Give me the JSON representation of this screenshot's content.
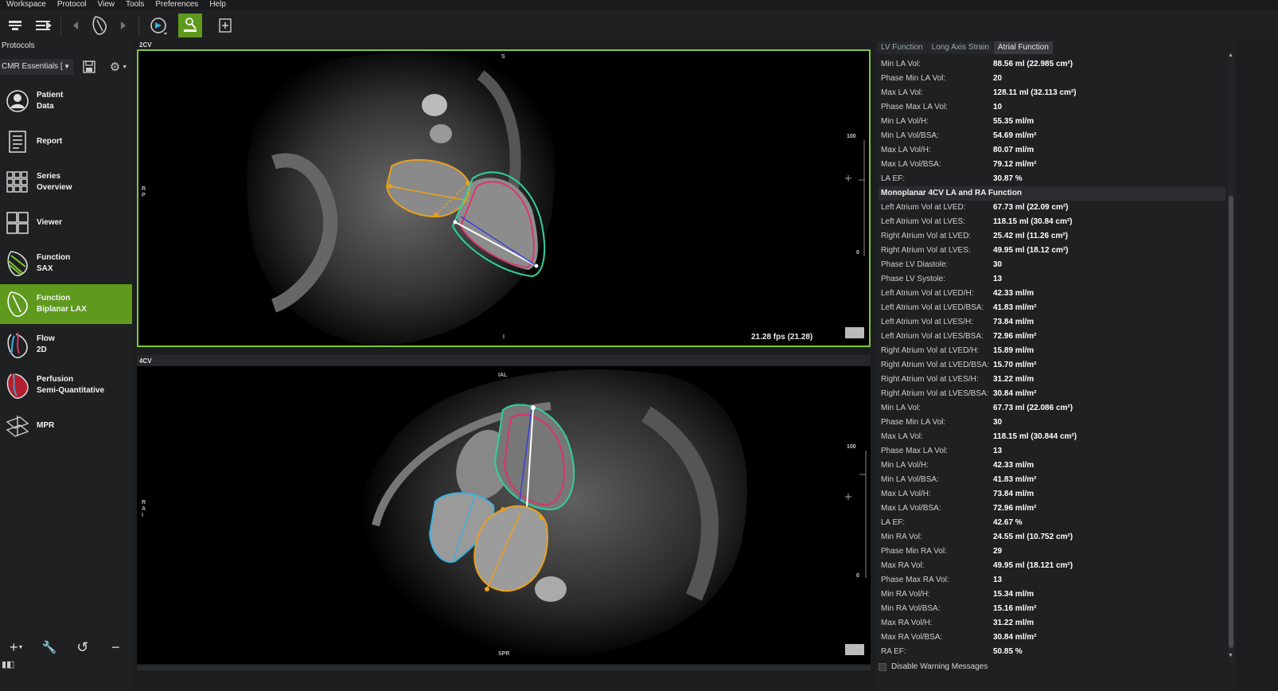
{
  "menu": [
    "Workspace",
    "Protocol",
    "View",
    "Tools",
    "Preferences",
    "Help"
  ],
  "left_panel": {
    "title": "Protocols",
    "protocol_select": "CMR Essentials [",
    "items": [
      {
        "label": "Patient\nData",
        "icon": "user-icon"
      },
      {
        "label": "Report",
        "icon": "report-icon"
      },
      {
        "label": "Series\nOverview",
        "icon": "grid-icon"
      },
      {
        "label": "Viewer",
        "icon": "viewer-icon"
      },
      {
        "label": "Function\nSAX",
        "icon": "heart-sax-icon"
      },
      {
        "label": "Function\nBiplanar LAX",
        "icon": "heart-lax-icon",
        "active": true
      },
      {
        "label": "Flow\n2D",
        "icon": "flow-icon"
      },
      {
        "label": "Perfusion\nSemi-Quantitative",
        "icon": "perfusion-icon"
      },
      {
        "label": "MPR",
        "icon": "mpr-icon"
      }
    ]
  },
  "views": {
    "top": {
      "label": "2CV",
      "ortho_top": "S",
      "ortho_left": "R\nP",
      "ortho_bottom": "I",
      "scale_top": "100",
      "scale_bottom": "0",
      "fps": "21.28 fps (21.28)"
    },
    "bottom": {
      "label": "4CV",
      "ortho_top": "IAL",
      "ortho_left": "R\nA\nI",
      "ortho_bottom": "SPR",
      "scale_top": "100",
      "scale_bottom": "0"
    }
  },
  "right_panel": {
    "tabs": [
      {
        "label": "LV Function",
        "active": false
      },
      {
        "label": "Long Axis Strain",
        "active": false
      },
      {
        "label": "Atrial Function",
        "active": true
      }
    ],
    "rows": [
      {
        "k": "Min LA Vol:",
        "v": "88.56 ml (22.985 cm²)"
      },
      {
        "k": "Phase Min LA Vol:",
        "v": "20"
      },
      {
        "k": "Max LA Vol:",
        "v": "128.11 ml (32.113 cm²)"
      },
      {
        "k": "Phase Max LA Vol:",
        "v": "10"
      },
      {
        "k": "Min LA Vol/H:",
        "v": "55.35 ml/m"
      },
      {
        "k": "Min LA Vol/BSA:",
        "v": "54.69 ml/m²"
      },
      {
        "k": "Max LA Vol/H:",
        "v": "80.07 ml/m"
      },
      {
        "k": "Max LA Vol/BSA:",
        "v": "79.12 ml/m²"
      },
      {
        "k": "LA EF:",
        "v": "30.87 %"
      },
      {
        "k": "Monoplanar 4CV LA and RA Function",
        "v": "",
        "header": true
      },
      {
        "k": "Left Atrium Vol at LVED:",
        "v": "67.73 ml (22.09 cm²)"
      },
      {
        "k": "Left Atrium Vol at LVES:",
        "v": "118.15 ml (30.84 cm²)"
      },
      {
        "k": "Right Atrium Vol at LVED:",
        "v": "25.42 ml (11.26 cm²)"
      },
      {
        "k": "Right Atrium Vol at LVES:",
        "v": "49.95 ml (18.12 cm²)"
      },
      {
        "k": "Phase LV Diastole:",
        "v": "30"
      },
      {
        "k": "Phase LV Systole:",
        "v": "13"
      },
      {
        "k": "Left Atrium Vol at LVED/H:",
        "v": "42.33 ml/m"
      },
      {
        "k": "Left Atrium Vol at LVED/BSA:",
        "v": "41.83 ml/m²"
      },
      {
        "k": "Left Atrium Vol at LVES/H:",
        "v": "73.84 ml/m"
      },
      {
        "k": "Left Atrium Vol at LVES/BSA:",
        "v": "72.96 ml/m²"
      },
      {
        "k": "Right Atrium Vol at LVED/H:",
        "v": "15.89 ml/m"
      },
      {
        "k": "Right Atrium Vol at LVED/BSA:",
        "v": "15.70 ml/m²"
      },
      {
        "k": "Right Atrium Vol at LVES/H:",
        "v": "31.22 ml/m"
      },
      {
        "k": "Right Atrium Vol at LVES/BSA:",
        "v": "30.84 ml/m²"
      },
      {
        "k": "Min LA Vol:",
        "v": "67.73 ml (22.086 cm²)"
      },
      {
        "k": "Phase Min LA Vol:",
        "v": "30"
      },
      {
        "k": "Max LA Vol:",
        "v": "118.15 ml (30.844 cm²)"
      },
      {
        "k": "Phase Max LA Vol:",
        "v": "13"
      },
      {
        "k": "Min LA Vol/H:",
        "v": "42.33 ml/m"
      },
      {
        "k": "Min LA Vol/BSA:",
        "v": "41.83 ml/m²"
      },
      {
        "k": "Max LA Vol/H:",
        "v": "73.84 ml/m"
      },
      {
        "k": "Max LA Vol/BSA:",
        "v": "72.96 ml/m²"
      },
      {
        "k": "LA EF:",
        "v": "42.67 %"
      },
      {
        "k": "Min RA Vol:",
        "v": "24.55 ml (10.752 cm²)"
      },
      {
        "k": "Phase Min RA Vol:",
        "v": "29"
      },
      {
        "k": "Max RA Vol:",
        "v": "49.95 ml (18.121 cm²)"
      },
      {
        "k": "Phase Max RA Vol:",
        "v": "13"
      },
      {
        "k": "Min RA Vol/H:",
        "v": "15.34 ml/m"
      },
      {
        "k": "Min RA Vol/BSA:",
        "v": "15.16 ml/m²"
      },
      {
        "k": "Max RA Vol/H:",
        "v": "31.22 ml/m"
      },
      {
        "k": "Max RA Vol/BSA:",
        "v": "30.84 ml/m²"
      },
      {
        "k": "RA EF:",
        "v": "50.85 %"
      }
    ],
    "footer_checkbox": "Disable Warning Messages"
  },
  "colors": {
    "accent": "#5f9a1e",
    "la_contour": "#e8a020",
    "ra_contour": "#3ab0e0",
    "lv_epi": "#30d0a0",
    "lv_endo": "#e0306a"
  }
}
